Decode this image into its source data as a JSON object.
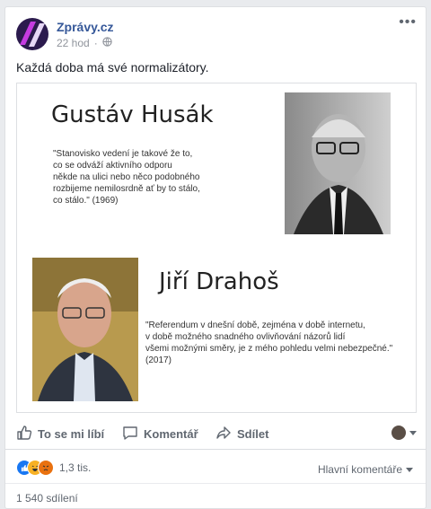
{
  "post": {
    "page_name": "Zprávy.cz",
    "time": "22 hod",
    "text": "Každá doba má své normalizátory."
  },
  "image": {
    "person1": {
      "name": "Gustáv Husák",
      "quote": "\"Stanovisko vedení je takové že to,\nco se odváží aktivního odporu\nněkde na ulici nebo něco podobného\nrozbijeme nemilosrdně ať by to stálo,\nco stálo.\" (1969)"
    },
    "person2": {
      "name": "Jiří Drahoš",
      "quote": "\"Referendum v dnešní době, zejména v době internetu,\nv době možného snadného ovlivňování názorů lidí\nvšemi možnými směry, je z mého pohledu velmi nebezpečné.\"\n(2017)"
    }
  },
  "actions": {
    "like": "To se mi líbí",
    "comment": "Komentář",
    "share": "Sdílet"
  },
  "stats": {
    "reactions_count": "1,3 tis.",
    "sort_label": "Hlavní komentáře",
    "shares": "1 540 sdílení"
  },
  "colors": {
    "link": "#365899",
    "like_blue": "#1877f2",
    "haha_yellow": "#f7b125",
    "angry_red": "#e9710f"
  }
}
